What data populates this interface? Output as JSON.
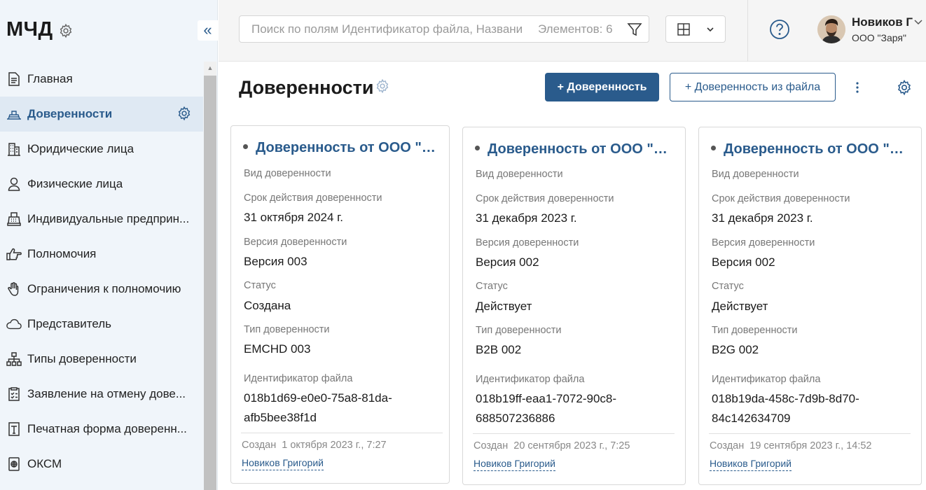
{
  "app": {
    "title": "МЧД"
  },
  "sidebar": {
    "collapse_label": "«",
    "items": [
      {
        "label": "Главная",
        "icon": "document-icon"
      },
      {
        "label": "Доверенности",
        "icon": "stamp-icon"
      },
      {
        "label": "Юридические лица",
        "icon": "building-icon"
      },
      {
        "label": "Физические лица",
        "icon": "person-icon"
      },
      {
        "label": "Индивидуальные предприн...",
        "icon": "cash-register-icon"
      },
      {
        "label": "Полномочия",
        "icon": "hand-point-icon"
      },
      {
        "label": "Ограничения к полномочию",
        "icon": "hand-stop-icon"
      },
      {
        "label": "Представитель",
        "icon": "cloud-icon"
      },
      {
        "label": "Типы доверенности",
        "icon": "hierarchy-icon"
      },
      {
        "label": "Заявление на отмену дове...",
        "icon": "clipboard-icon"
      },
      {
        "label": "Печатная форма доверенн...",
        "icon": "print-form-icon"
      },
      {
        "label": "ОКСМ",
        "icon": "globe-icon"
      }
    ]
  },
  "topbar": {
    "search_placeholder": "Поиск по полям Идентификатор файла, Название",
    "items_count": "Элементов: 6",
    "user_name": "Новиков Г",
    "user_company": "ООО \"Заря\""
  },
  "main": {
    "title": "Доверенности",
    "add_button": "+ Доверенность",
    "add_from_file_button": "+ Доверенность из файла"
  },
  "labels": {
    "kind": "Вид доверенности",
    "validity": "Срок действия доверенности",
    "version": "Версия доверенности",
    "status": "Статус",
    "type": "Тип доверенности",
    "file_id": "Идентификатор файла",
    "created": "Создан"
  },
  "cards": [
    {
      "title": "Доверенность от ООО \"Заря\"",
      "validity": "31 октября 2024 г.",
      "version": "Версия 003",
      "status": "Создана",
      "type": "EMCHD 003",
      "file_id_1": "018b1d69-e0e0-75a8-81da-",
      "file_id_2": "afb5bee38f1d",
      "created_at": "1 октября 2023 г., 7:27",
      "author": "Новиков Григорий"
    },
    {
      "title": "Доверенность от ООО \"Заря\"",
      "validity": "31 декабря 2023 г.",
      "version": "Версия 002",
      "status": "Действует",
      "type": "B2B 002",
      "file_id_1": "018b19ff-eaa1-7072-90c8-",
      "file_id_2": "688507236886",
      "created_at": "20 сентября 2023 г., 7:25",
      "author": "Новиков Григорий"
    },
    {
      "title": "Доверенность от ООО \"Заря\"",
      "validity": "31 декабря 2023 г.",
      "version": "Версия 002",
      "status": "Действует",
      "type": "B2G 002",
      "file_id_1": "018b19da-458c-7d9b-8d70-",
      "file_id_2": "84c142634709",
      "created_at": "19 сентября 2023 г., 14:52",
      "author": "Новиков Григорий"
    }
  ],
  "colors": {
    "accent": "#2a5b8c",
    "sidebar_bg": "#f0f5fa",
    "active_bg": "#dfe9f3"
  }
}
